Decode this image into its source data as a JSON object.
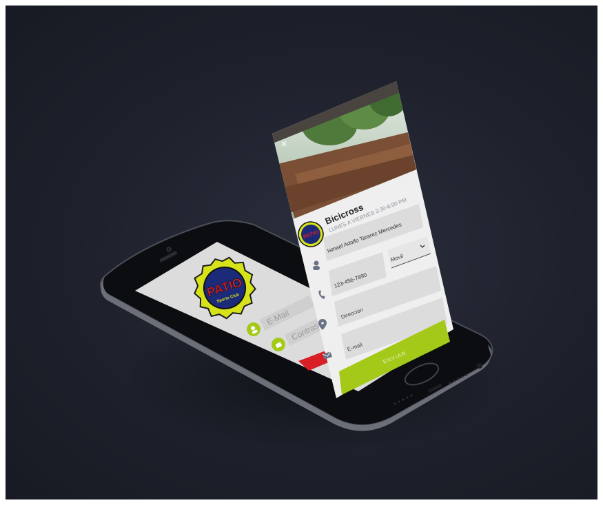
{
  "login": {
    "logo_text": "PATIO",
    "logo_subtext": "Sports Club",
    "email_placeholder": "E-Mail",
    "password_placeholder": "Contraseña"
  },
  "card": {
    "close_label": "✕",
    "title": "Bicicross",
    "schedule": "LUNES A VIERNES 3:30-6:00 PM",
    "name_value": "Ismael Adolfo Tararez Mercedes",
    "phone_value": "123-456-7890",
    "phone_type": "Movil",
    "address_placeholder": "Direccion",
    "email_placeholder": "E-mail",
    "submit_label": "ENVIAR"
  },
  "colors": {
    "background": "#1e212c",
    "accent_green": "#a4c918",
    "danger_red": "#d81f26",
    "logo_navy": "#1c2a7a",
    "logo_yellow": "#d6e21a",
    "icon_gray": "#6a7386"
  },
  "icons": [
    "close-icon",
    "user-icon",
    "phone-icon",
    "location-pin-icon",
    "envelope-icon",
    "chevron-down-icon"
  ]
}
